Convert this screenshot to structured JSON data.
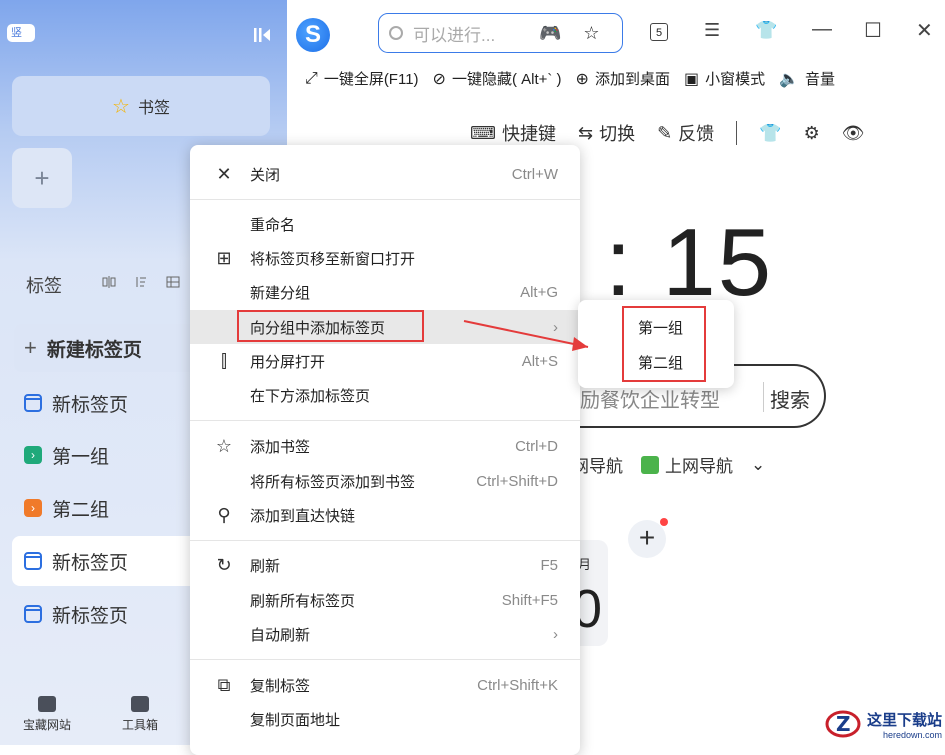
{
  "sidebar": {
    "badge": "竖",
    "bookmarks_label": "书签",
    "add": "+",
    "tabs_header": "标签",
    "new_tab": "新建标签页",
    "items": [
      {
        "label": "新标签页",
        "icon": "browser-tab-icon",
        "active": false
      },
      {
        "label": "第一组",
        "icon": "group-green-icon",
        "active": false
      },
      {
        "label": "第二组",
        "icon": "group-orange-icon",
        "active": false
      },
      {
        "label": "新标签页",
        "icon": "browser-tab-icon",
        "active": true
      },
      {
        "label": "新标签页",
        "icon": "browser-tab-icon",
        "active": false
      }
    ],
    "bottom": [
      {
        "label": "宝藏网站",
        "icon": "treasure-site-icon"
      },
      {
        "label": "工具箱",
        "icon": "toolbox-icon"
      }
    ]
  },
  "topbar": {
    "search_placeholder": "可以进行...",
    "tab_count": "5"
  },
  "toolbar2": [
    {
      "icon": "fullscreen-icon",
      "glyph": "⤢",
      "label": "一键全屏(F11)"
    },
    {
      "icon": "hide-icon",
      "glyph": "⊘",
      "label": "一键隐藏( Alt+` )"
    },
    {
      "icon": "desktop-add-icon",
      "glyph": "⊕",
      "label": "添加到桌面"
    },
    {
      "icon": "mini-window-icon",
      "glyph": "▣",
      "label": "小窗模式"
    },
    {
      "icon": "volume-icon",
      "glyph": "🔈",
      "label": "音量"
    }
  ],
  "newtab_tools": {
    "shortcuts": "快捷键",
    "switch": "切换",
    "feedback": "反馈"
  },
  "clock_text": ": 15",
  "search": {
    "query": "励餐饮企业转型",
    "button": "搜索"
  },
  "nav": {
    "left": "网导航",
    "right": "上网导航"
  },
  "calendar": {
    "month": "月",
    "day": "0"
  },
  "context_menu": [
    {
      "label": "关闭",
      "shortcut": "Ctrl+W",
      "icon": "close-icon",
      "glyph": "✕"
    },
    {
      "label": "重命名",
      "shortcut": "",
      "icon": "",
      "glyph": ""
    },
    {
      "label": "将标签页移至新窗口打开",
      "shortcut": "",
      "icon": "new-window-icon",
      "glyph": "⊞"
    },
    {
      "label": "新建分组",
      "shortcut": "Alt+G",
      "icon": "",
      "glyph": ""
    },
    {
      "label": "向分组中添加标签页",
      "shortcut": "›",
      "icon": "",
      "glyph": ""
    },
    {
      "label": "用分屏打开",
      "shortcut": "Alt+S",
      "icon": "split-screen-icon",
      "glyph": "⫿"
    },
    {
      "label": "在下方添加标签页",
      "shortcut": "",
      "icon": "",
      "glyph": ""
    },
    {
      "label": "添加书签",
      "shortcut": "Ctrl+D",
      "icon": "star-add-icon",
      "glyph": "☆"
    },
    {
      "label": "将所有标签页添加到书签",
      "shortcut": "Ctrl+Shift+D",
      "icon": "",
      "glyph": ""
    },
    {
      "label": "添加到直达快链",
      "shortcut": "",
      "icon": "quick-link-icon",
      "glyph": "⚲"
    },
    {
      "label": "刷新",
      "shortcut": "F5",
      "icon": "refresh-icon",
      "glyph": "↻"
    },
    {
      "label": "刷新所有标签页",
      "shortcut": "Shift+F5",
      "icon": "",
      "glyph": ""
    },
    {
      "label": "自动刷新",
      "shortcut": "›",
      "icon": "",
      "glyph": ""
    },
    {
      "label": "复制标签",
      "shortcut": "Ctrl+Shift+K",
      "icon": "copy-icon",
      "glyph": "⧉"
    },
    {
      "label": "复制页面地址",
      "shortcut": "",
      "icon": "",
      "glyph": ""
    }
  ],
  "submenu": [
    "第一组",
    "第二组"
  ],
  "watermark": {
    "title": "这里下载站",
    "site": "heredown.com"
  },
  "colors": {
    "accent": "#3b7be8",
    "highlight_box": "#e43b3b",
    "sidebar_top": "#7fa6ec"
  }
}
